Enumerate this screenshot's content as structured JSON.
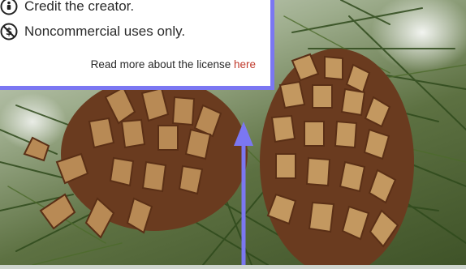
{
  "license": {
    "row1_text": "Credit the creator.",
    "row2_text": "Noncommercial uses only.",
    "read_more_text": "Read more about the license ",
    "read_more_link": "here",
    "icons": [
      "cc-by-icon",
      "cc-nc-icon"
    ]
  },
  "colors": {
    "accent": "#7b77f2",
    "link": "#c0392b"
  }
}
